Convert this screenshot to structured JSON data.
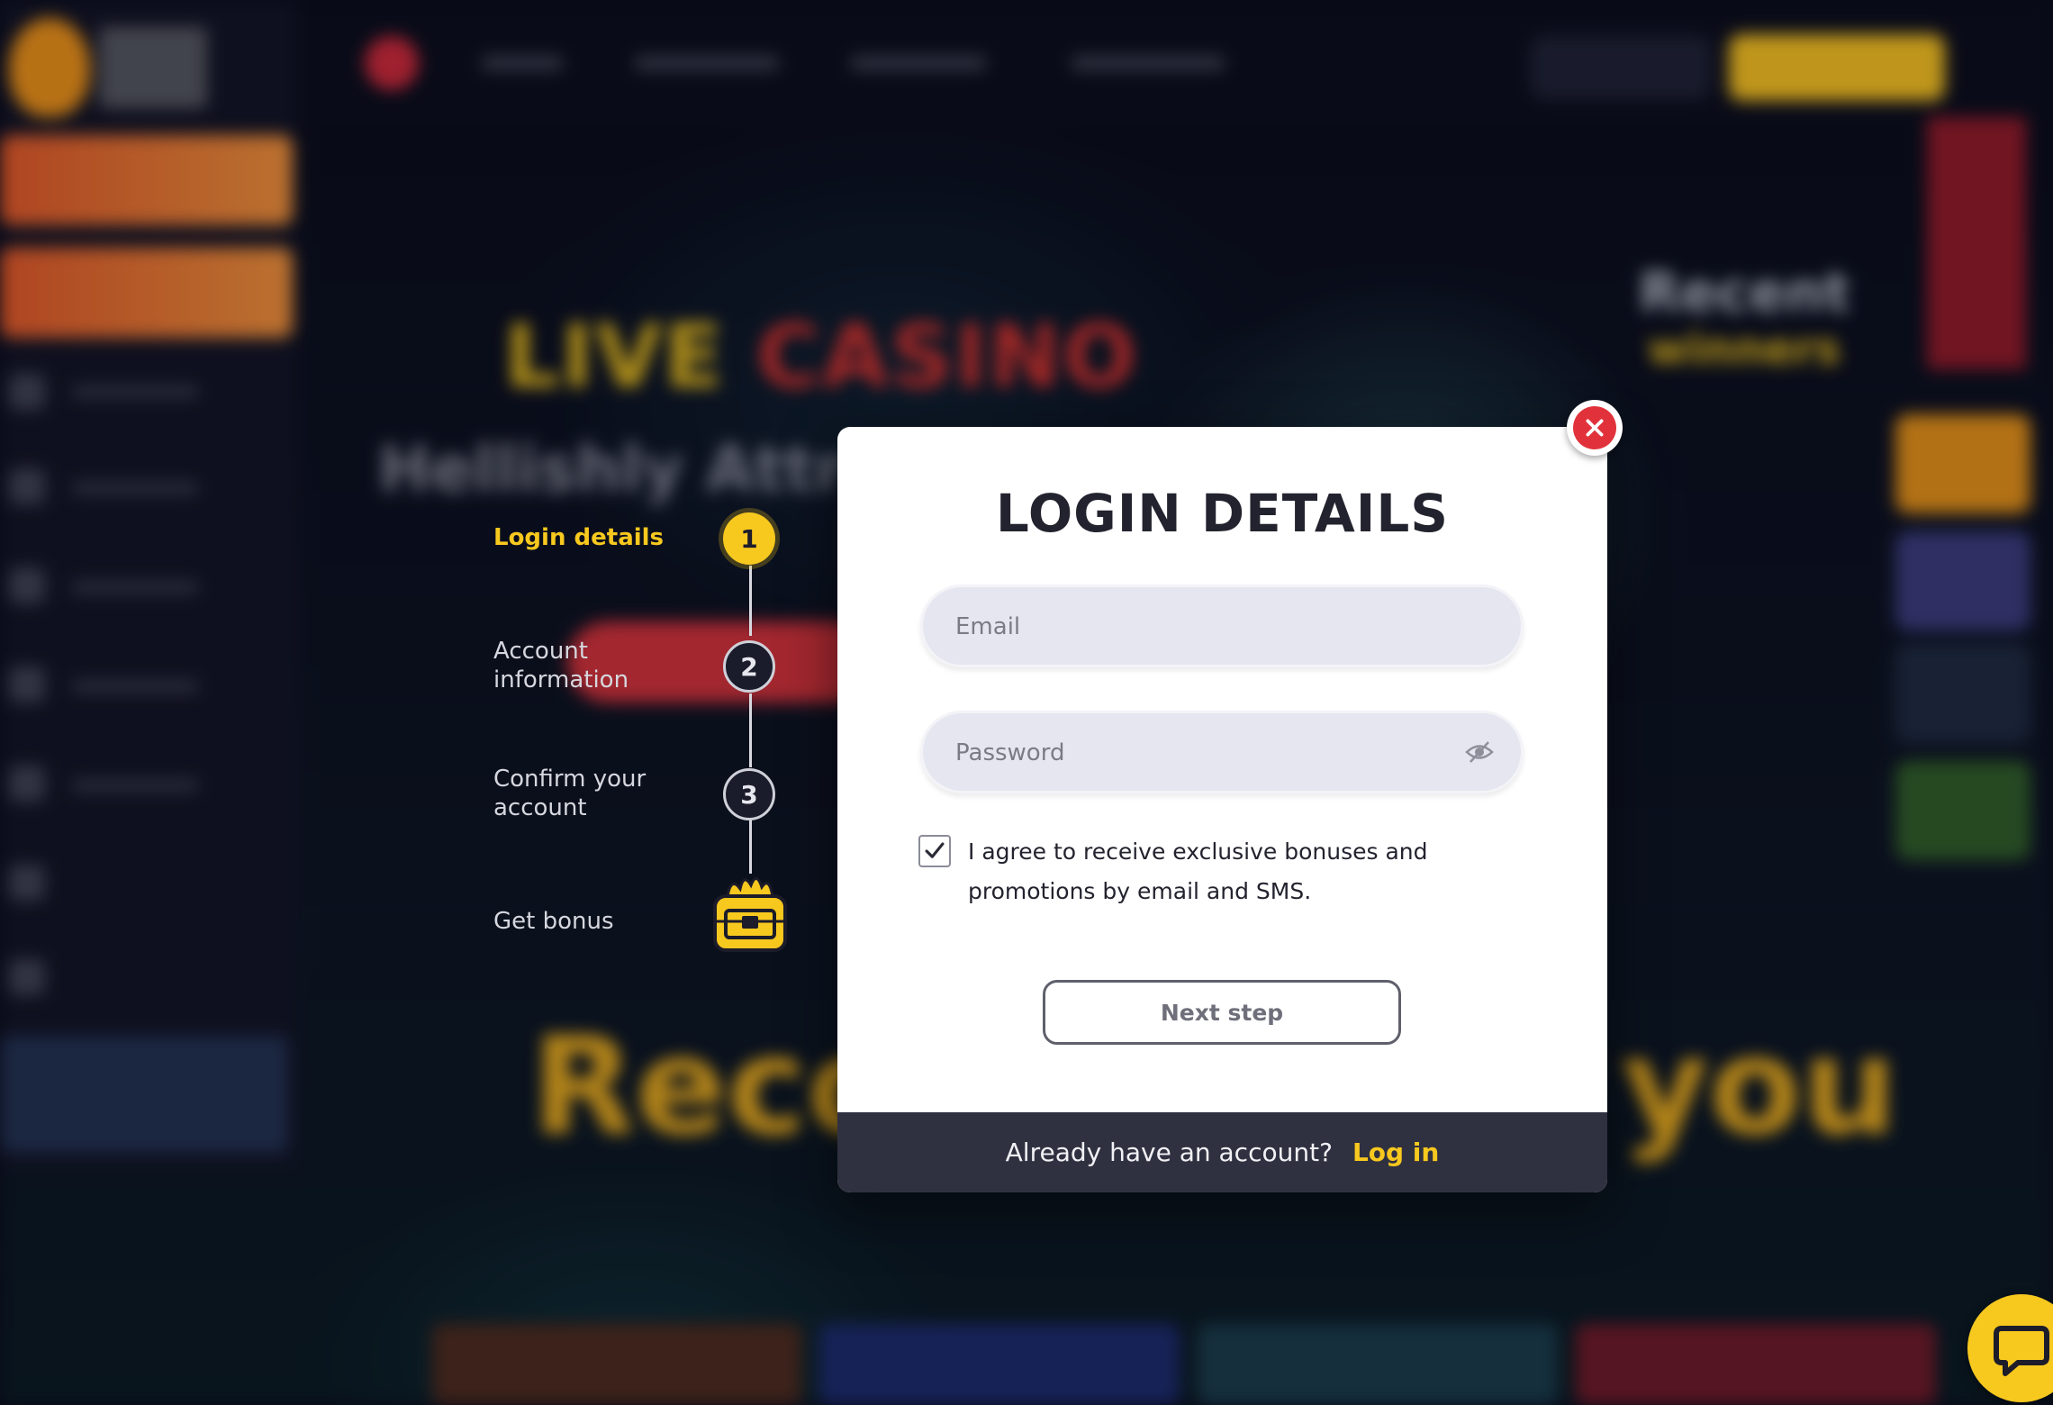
{
  "stepper": {
    "steps": [
      {
        "number": "1",
        "label": "Login details",
        "state": "active"
      },
      {
        "number": "2",
        "label": "Account information",
        "state": "inactive"
      },
      {
        "number": "3",
        "label": "Confirm your account",
        "state": "inactive"
      },
      {
        "number": "",
        "label": "Get bonus",
        "icon": "treasure-chest-icon",
        "state": "inactive"
      }
    ]
  },
  "modal": {
    "title": "LOGIN DETAILS",
    "email_placeholder": "Email",
    "password_placeholder": "Password",
    "consent_text": "I agree to receive exclusive bonuses and promotions by email and SMS.",
    "consent_checked": true,
    "next_button": "Next step",
    "footer_text": "Already have an account?",
    "footer_link": "Log in"
  },
  "background": {
    "hero_word_1": "LIVE",
    "hero_word_2": "CASINO",
    "hero_subtitle": "Hellishly Attra",
    "section_left": "Reco",
    "section_right": "you",
    "recent_title": "Recent",
    "recent_subtitle": "winners"
  },
  "colors": {
    "accent": "#f7c81e",
    "close_red": "#e1323b",
    "footer_bg": "#303140",
    "page_bg": "#0b0d1e"
  },
  "icons": {
    "close": "close-icon",
    "eye": "eye-slash-icon",
    "check": "checkmark-icon",
    "chat": "chat-icon"
  }
}
